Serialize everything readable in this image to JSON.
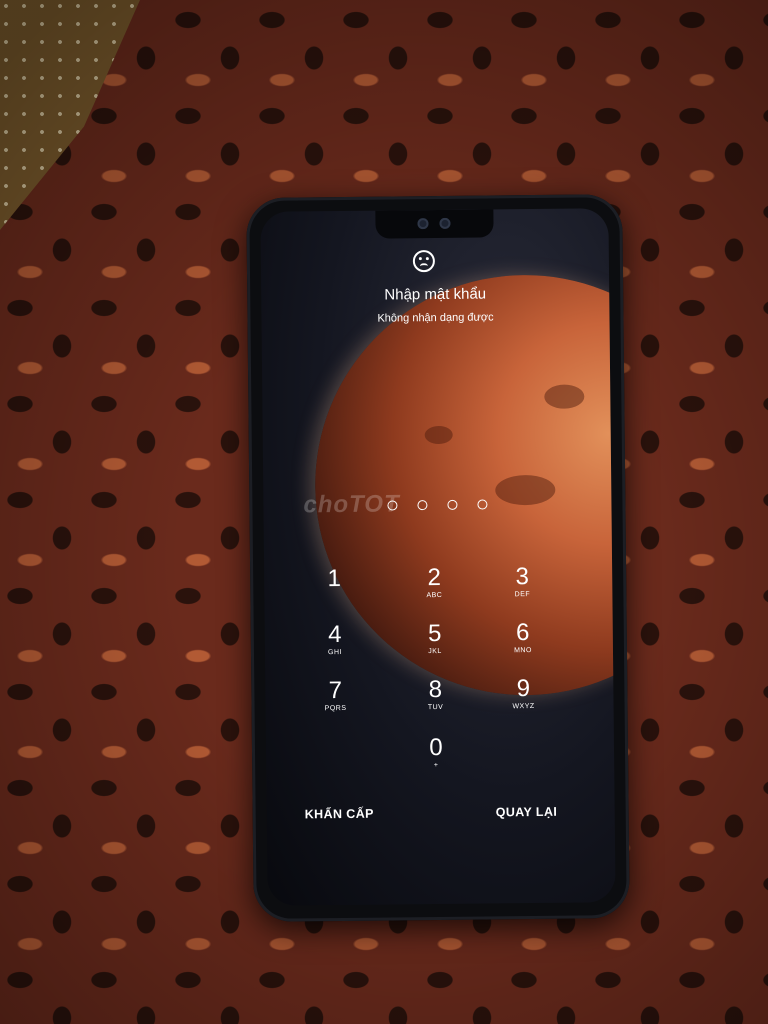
{
  "lock_screen": {
    "icon": "sad-face-icon",
    "title": "Nhập mật khẩu",
    "subtitle": "Không nhận dạng được",
    "pin_dots_count": 4,
    "keys": [
      {
        "digit": "1",
        "letters": ""
      },
      {
        "digit": "2",
        "letters": "ABC"
      },
      {
        "digit": "3",
        "letters": "DEF"
      },
      {
        "digit": "4",
        "letters": "GHI"
      },
      {
        "digit": "5",
        "letters": "JKL"
      },
      {
        "digit": "6",
        "letters": "MNO"
      },
      {
        "digit": "7",
        "letters": "PQRS"
      },
      {
        "digit": "8",
        "letters": "TUV"
      },
      {
        "digit": "9",
        "letters": "WXYZ"
      },
      {
        "digit": "0",
        "letters": "+"
      }
    ],
    "emergency_label": "KHẨN CẤP",
    "back_label": "QUAY LẠI"
  },
  "watermark": "choTOT"
}
